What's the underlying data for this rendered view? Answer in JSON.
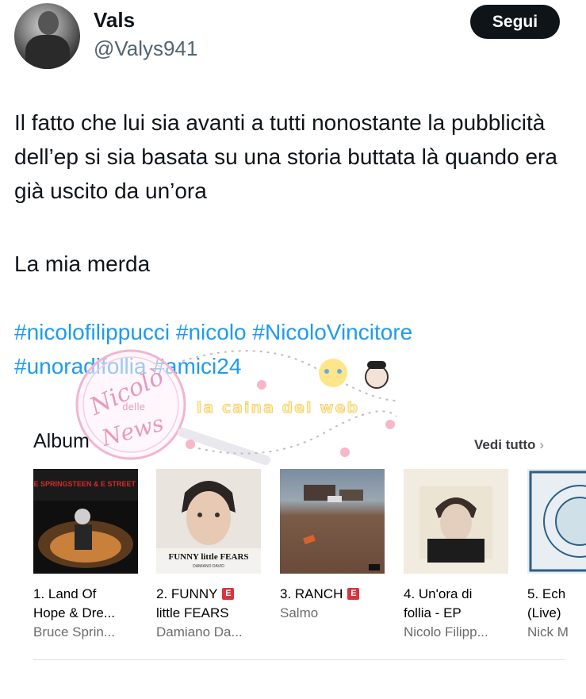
{
  "author": {
    "name": "Vals",
    "handle": "@Valys941",
    "follow_label": "Segui"
  },
  "tweet": {
    "line1": "Il fatto che lui sia avanti a tutti nonostante la pubblicità dell’ep si sia basata su una storia buttata là quando era già uscito da un’ora",
    "line2": "La mia merda",
    "hashtags": [
      "#nicolofilippucci",
      "#nicolo",
      "#NicoloVincitore",
      "#unoradifollia",
      "#amici24"
    ]
  },
  "watermark": {
    "circle_text_1": "Nicolò",
    "circle_text_2": "delle",
    "circle_text_3": "News",
    "banner_text": "la caina del web"
  },
  "albums_section": {
    "title": "Album",
    "see_all": "Vedi tutto",
    "see_all_chevron": "›",
    "items": [
      {
        "title_line1": "1. Land Of",
        "title_line2": "Hope & Dre...",
        "artist": "Bruce Sprin...",
        "explicit": false,
        "cover_text": "BRUCE SPRINGSTEEN & E STREET BAND"
      },
      {
        "title_line1": "2. FUNNY",
        "title_line2": "little FEARS",
        "artist": "Damiano Da...",
        "explicit": true,
        "cover_text": "FUNNY little FEARS",
        "cover_subtext": "DAMIANO DAVID"
      },
      {
        "title_line1": "3. RANCH",
        "title_line2": "",
        "artist": "Salmo",
        "explicit": true
      },
      {
        "title_line1": "4. Un'ora di",
        "title_line2": "follia - EP",
        "artist": "Nicolo Filipp...",
        "explicit": false
      },
      {
        "title_line1": "5. Ech",
        "title_line2": "(Live)",
        "artist": "Nick M",
        "explicit": false
      }
    ],
    "explicit_label": "E"
  }
}
